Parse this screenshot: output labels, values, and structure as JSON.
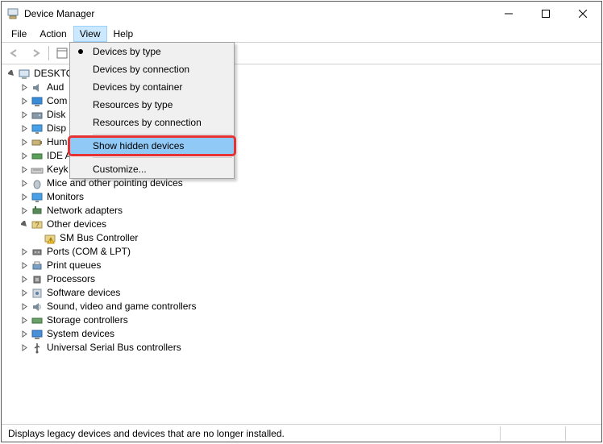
{
  "title": "Device Manager",
  "menus": {
    "file": "File",
    "action": "Action",
    "view": "View",
    "help": "Help"
  },
  "view_menu": {
    "by_type": "Devices by type",
    "by_connection": "Devices by connection",
    "by_container": "Devices by container",
    "res_by_type": "Resources by type",
    "res_by_connection": "Resources by connection",
    "show_hidden": "Show hidden devices",
    "customize": "Customize..."
  },
  "root": "DESKTO",
  "nodes": {
    "audio": "Aud",
    "computer": "Com",
    "disk": "Disk",
    "display": "Disp",
    "hid": "Hum",
    "ide": "IDE A",
    "keyboards": "Keyk",
    "mice": "Mice and other pointing devices",
    "monitors": "Monitors",
    "network": "Network adapters",
    "other": "Other devices",
    "smbus": "SM Bus Controller",
    "ports": "Ports (COM & LPT)",
    "printq": "Print queues",
    "processors": "Processors",
    "software": "Software devices",
    "sound": "Sound, video and game controllers",
    "storage": "Storage controllers",
    "system": "System devices",
    "usb": "Universal Serial Bus controllers"
  },
  "status": "Displays legacy devices and devices that are no longer installed."
}
